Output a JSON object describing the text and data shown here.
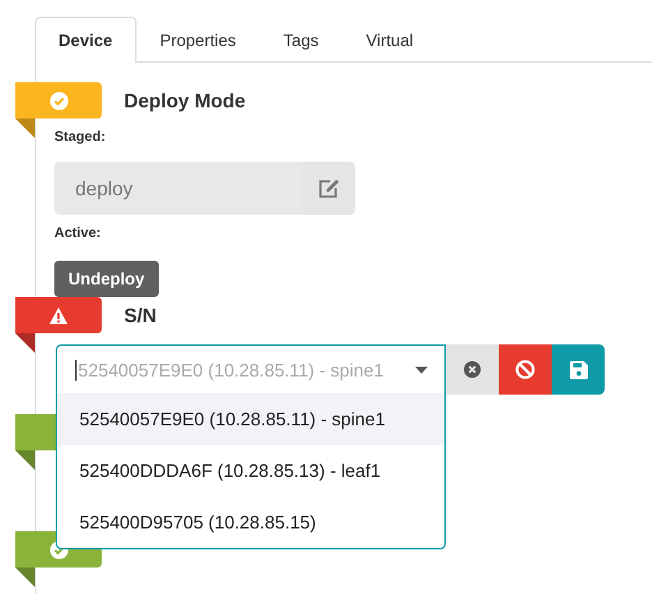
{
  "tabs": [
    {
      "label": "Device",
      "selected": true
    },
    {
      "label": "Properties",
      "selected": false
    },
    {
      "label": "Tags",
      "selected": false
    },
    {
      "label": "Virtual",
      "selected": false
    }
  ],
  "sections": [
    {
      "color": "#fbb51f",
      "kind": "check",
      "title": "Deploy Mode",
      "body": [
        {
          "kind": "label",
          "text": "Staged:"
        },
        {
          "kind": "field",
          "value": "deploy"
        },
        {
          "kind": "label",
          "text": "Active:"
        },
        {
          "kind": "button",
          "label": "Undeploy"
        }
      ]
    },
    {
      "color": "#e63b2e",
      "kind": "alert",
      "title": "S/N",
      "body": [
        {
          "kind": "select",
          "placeholder": "52540057E9E0 (10.28.85.11) - spine1",
          "expanded": true,
          "options": [
            {
              "label": "52540057E9E0 (10.28.85.11) - spine1",
              "selected": true
            },
            {
              "label": "525400DDDA6F (10.28.85.13) - leaf1",
              "selected": false
            },
            {
              "label": "525400D95705 (10.28.85.15)",
              "selected": false
            }
          ]
        }
      ]
    },
    {
      "color": "#8ab33a",
      "kind": "covered"
    },
    {
      "color": "#8ab33a",
      "kind": "check"
    }
  ]
}
